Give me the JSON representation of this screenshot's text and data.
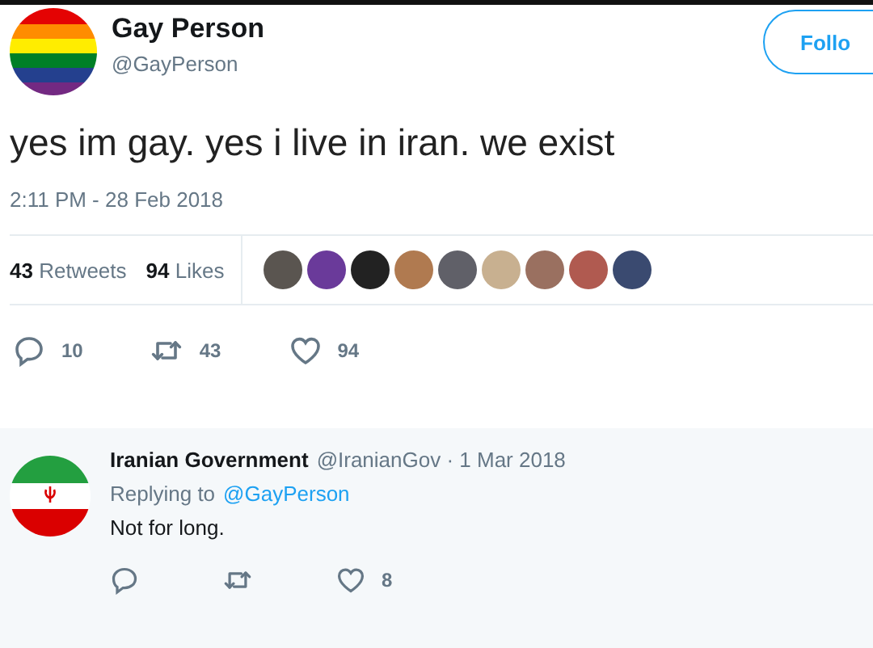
{
  "tweet": {
    "author": {
      "name": "Gay Person",
      "handle": "@GayPerson"
    },
    "follow_button": "Follo",
    "text": "yes im gay. yes i live in iran. we exist",
    "timestamp": "2:11 PM - 28 Feb 2018",
    "stats": [
      {
        "count": "43",
        "label": "Retweets"
      },
      {
        "count": "94",
        "label": "Likes"
      }
    ],
    "actions": [
      {
        "kind": "reply",
        "count": "10"
      },
      {
        "kind": "retweet",
        "count": "43"
      },
      {
        "kind": "like",
        "count": "94"
      }
    ]
  },
  "reply": {
    "name": "Iranian Government",
    "meta": "@IranianGov · 1 Mar 2018",
    "replying_prefix": "Replying to",
    "replying_to": "@GayPerson",
    "text": "Not for long.",
    "actions": [
      {
        "kind": "reply"
      },
      {
        "kind": "retweet"
      },
      {
        "kind": "like",
        "count": "8"
      }
    ]
  }
}
